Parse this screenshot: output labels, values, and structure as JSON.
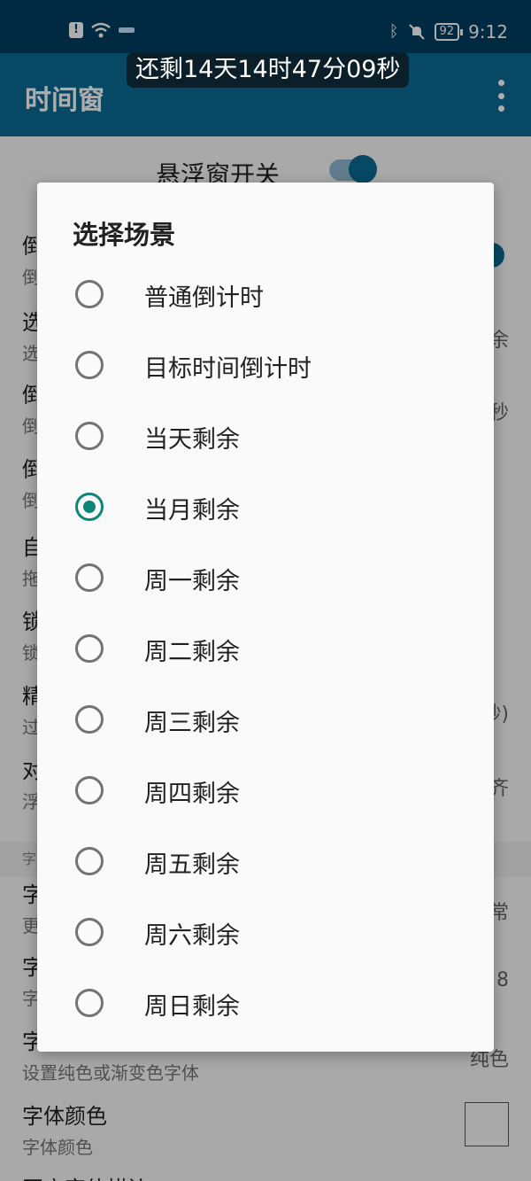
{
  "status_bar": {
    "time": "9:12",
    "battery": "92",
    "icons": [
      "alert-icon",
      "wifi-icon",
      "bluetooth-icon",
      "mute-bell-icon"
    ]
  },
  "floating_timer": "还剩14天14时47分09秒",
  "app_bar": {
    "title": "时间窗"
  },
  "background": {
    "switch_label": "悬浮窗开关",
    "items": [
      {
        "title": "倒",
        "sub": "倒"
      },
      {
        "title": "选",
        "sub": "选",
        "value": "余"
      },
      {
        "title": "倒",
        "sub": "倒",
        "value": "秒"
      },
      {
        "title": "倒",
        "sub": "倒"
      },
      {
        "title": "自",
        "sub": "拖"
      },
      {
        "title": "锁",
        "sub": "锁"
      },
      {
        "title": "精",
        "sub": "过",
        "value": "秒)"
      },
      {
        "title": "对",
        "sub": "浮",
        "value": "齐"
      }
    ],
    "section": "字",
    "font_items": [
      {
        "title": "字",
        "sub": "更",
        "value": "常"
      },
      {
        "title": "字",
        "sub": "字",
        "value": "8"
      },
      {
        "title": "字",
        "sub": "设置纯色或渐变色字体",
        "value": "纯色"
      },
      {
        "title": "字体颜色",
        "sub": "字体颜色"
      },
      {
        "title": "开启字体描边"
      }
    ]
  },
  "dialog": {
    "title": "选择场景",
    "options": [
      {
        "label": "普通倒计时",
        "checked": false
      },
      {
        "label": "目标时间倒计时",
        "checked": false
      },
      {
        "label": "当天剩余",
        "checked": false
      },
      {
        "label": "当月剩余",
        "checked": true
      },
      {
        "label": "周一剩余",
        "checked": false
      },
      {
        "label": "周二剩余",
        "checked": false
      },
      {
        "label": "周三剩余",
        "checked": false
      },
      {
        "label": "周四剩余",
        "checked": false
      },
      {
        "label": "周五剩余",
        "checked": false
      },
      {
        "label": "周六剩余",
        "checked": false
      },
      {
        "label": "周日剩余",
        "checked": false
      }
    ]
  },
  "colors": {
    "status_bar": "#003f60",
    "app_bar": "#0b6b96",
    "radio_accent": "#0f8577"
  }
}
